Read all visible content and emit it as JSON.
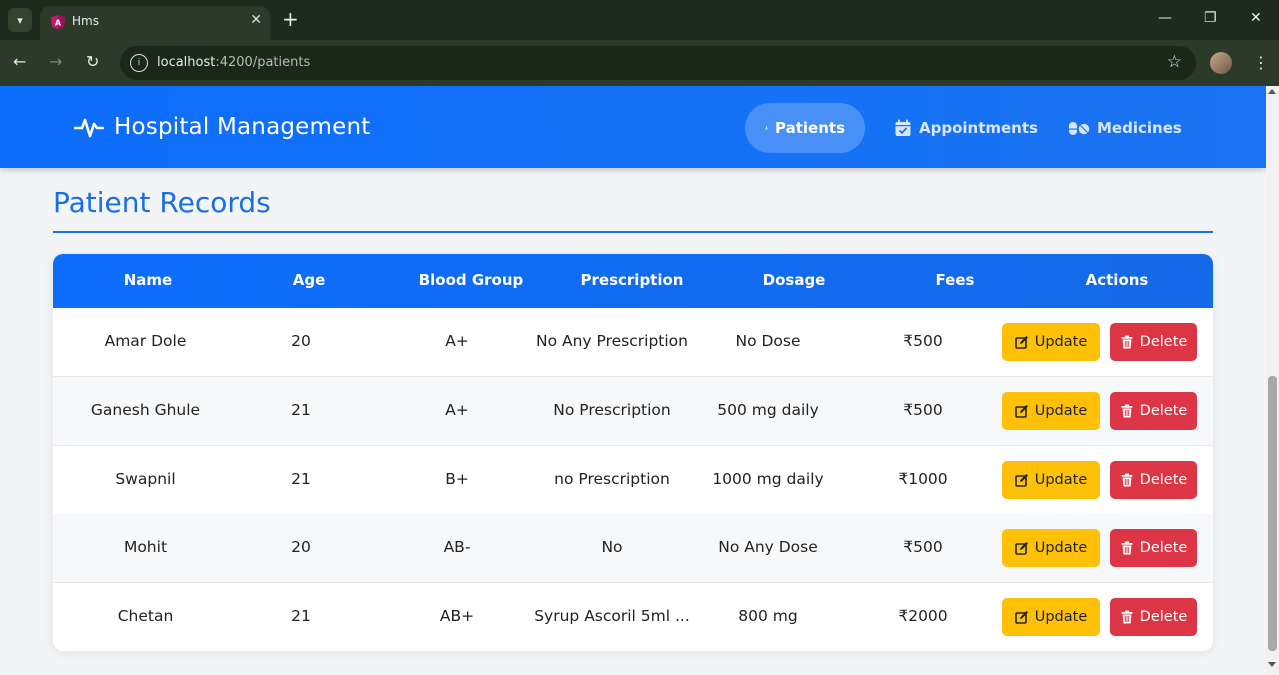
{
  "browser": {
    "tab_title": "Hms",
    "tab_close": "✕",
    "new_tab": "+",
    "url_host": "localhost",
    "url_path": ":4200/patients",
    "window_controls": {
      "minimize": "—",
      "restore": "❐",
      "close": "✕"
    }
  },
  "navbar": {
    "brand": "Hospital Management",
    "links": [
      {
        "label": "Patients",
        "icon": "user-doctor-icon",
        "active": true
      },
      {
        "label": "Appointments",
        "icon": "calendar-check-icon",
        "active": false
      },
      {
        "label": "Medicines",
        "icon": "pills-icon",
        "active": false
      }
    ]
  },
  "page": {
    "title": "Patient Records"
  },
  "table": {
    "columns": [
      "Name",
      "Age",
      "Blood Group",
      "Prescription",
      "Dosage",
      "Fees",
      "Actions"
    ],
    "rows": [
      {
        "name": "Amar Dole",
        "age": "20",
        "blood_group": "A+",
        "prescription": "No Any Prescription",
        "dosage": "No Dose",
        "fees": "₹500"
      },
      {
        "name": "Ganesh Ghule",
        "age": "21",
        "blood_group": "A+",
        "prescription": "No Prescription",
        "dosage": "500 mg daily",
        "fees": "₹500"
      },
      {
        "name": "Swapnil",
        "age": "21",
        "blood_group": "B+",
        "prescription": "no Prescription",
        "dosage": "1000 mg daily",
        "fees": "₹1000"
      },
      {
        "name": "Mohit",
        "age": "20",
        "blood_group": "AB-",
        "prescription": "No",
        "dosage": "No Any Dose",
        "fees": "₹500"
      },
      {
        "name": "Chetan",
        "age": "21",
        "blood_group": "AB+",
        "prescription": "Syrup Ascoril 5ml ...",
        "dosage": "800 mg",
        "fees": "₹2000"
      }
    ],
    "update_label": "Update",
    "delete_label": "Delete"
  },
  "colors": {
    "primary": "#0d6efd",
    "warning": "#ffc107",
    "danger": "#dc3545",
    "title": "#1a6fe6"
  }
}
